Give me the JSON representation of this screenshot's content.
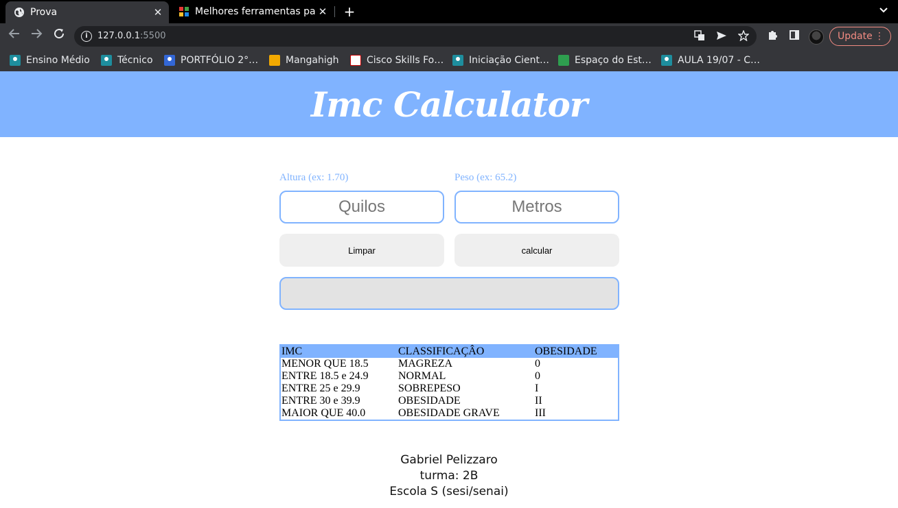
{
  "browser": {
    "tabs": [
      {
        "title": "Prova",
        "active": true,
        "icon": "globe-icon"
      },
      {
        "title": "Melhores ferramentas pa",
        "active": false,
        "icon": "tools-site-icon"
      }
    ],
    "close_glyph": "✕",
    "new_tab_glyph": "+",
    "url_host": "127.0.0.1",
    "url_port": ":5500",
    "update_label": "Update",
    "bookmarks": [
      {
        "label": "Ensino Médio",
        "icon": "classroom-icon"
      },
      {
        "label": "Técnico",
        "icon": "classroom-icon"
      },
      {
        "label": "PORTFÓLIO 2°…",
        "icon": "classroom-blue-icon"
      },
      {
        "label": "Mangahigh",
        "icon": "mangahigh-icon"
      },
      {
        "label": "Cisco Skills Fo…",
        "icon": "cisco-icon"
      },
      {
        "label": "Iniciação Cient…",
        "icon": "classroom-icon"
      },
      {
        "label": "Espaço do Est…",
        "icon": "espaco-icon"
      },
      {
        "label": "AULA 19/07 - C…",
        "icon": "classroom-icon"
      }
    ]
  },
  "header": {
    "title": "Imc Calculator",
    "background": "#80b3ff"
  },
  "form": {
    "altura_label": "Altura (ex: 1.70)",
    "peso_label": "Peso (ex: 65.2)",
    "altura_placeholder": "Quilos",
    "peso_placeholder": "Metros",
    "clear_label": "Limpar",
    "calc_label": "calcular",
    "result_value": ""
  },
  "table": {
    "headers": [
      "IMC",
      "CLASSIFICAÇÂO",
      "OBESIDADE"
    ],
    "rows": [
      [
        "MENOR QUE 18.5",
        "MAGREZA",
        "0"
      ],
      [
        "ENTRE 18.5 e 24.9",
        "NORMAL",
        "0"
      ],
      [
        "ENTRE 25 e 29.9",
        "SOBREPESO",
        "I"
      ],
      [
        "ENTRE 30 e 39.9",
        "OBESIDADE",
        "II"
      ],
      [
        "MAIOR QUE 40.0",
        "OBESIDADE GRAVE",
        "III"
      ]
    ]
  },
  "footer": {
    "name": "Gabriel Pelizzaro",
    "class": "turma: 2B",
    "school": "Escola S (sesi/senai)"
  },
  "colors": {
    "accent": "#80b3ff",
    "update": "#f28b82"
  }
}
